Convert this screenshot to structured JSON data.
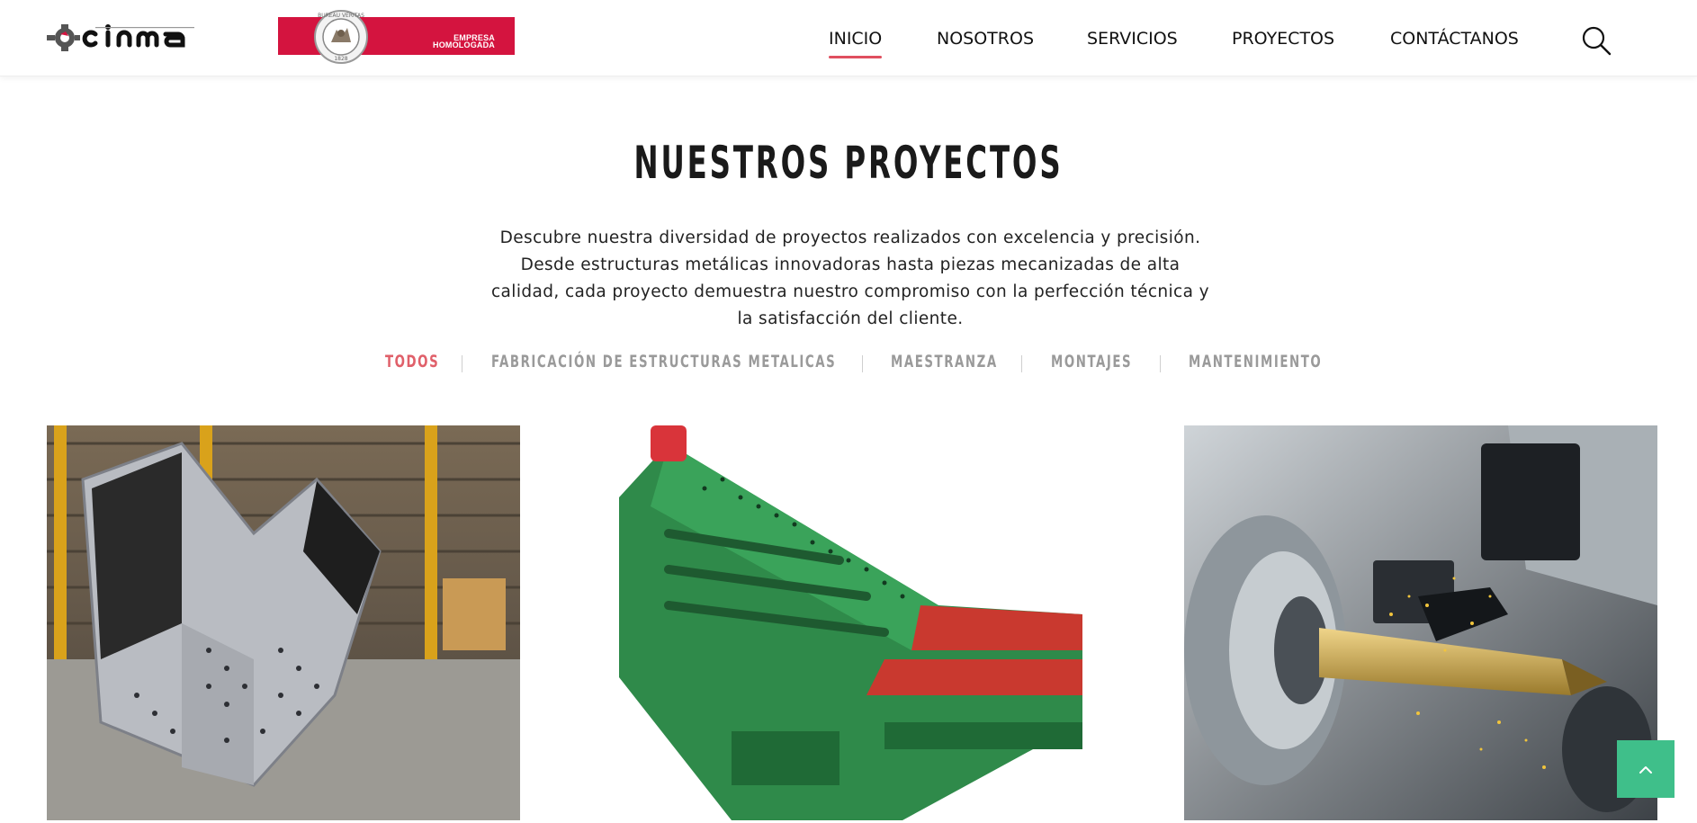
{
  "brand": {
    "logo_text": "cinma",
    "badge_line1": "EMPRESA",
    "badge_line2": "HOMOLOGADA",
    "seal_text": "BUREAU VERITAS",
    "seal_year": "1828"
  },
  "nav": {
    "items": [
      {
        "label": "INICIO",
        "active": true
      },
      {
        "label": "NOSOTROS",
        "active": false
      },
      {
        "label": "SERVICIOS",
        "active": false
      },
      {
        "label": "PROYECTOS",
        "active": false
      },
      {
        "label": "CONTÁCTANOS",
        "active": false
      }
    ],
    "search_icon": "search-icon"
  },
  "section": {
    "title": "NUESTROS PROYECTOS",
    "description_lines": [
      "Descubre nuestra diversidad de proyectos realizados con excelencia y precisión.",
      "Desde estructuras metálicas innovadoras hasta piezas mecanizadas de alta",
      "calidad, cada proyecto demuestra nuestro compromiso con la perfección técnica y",
      "la satisfacción del cliente."
    ]
  },
  "filters": {
    "items": [
      {
        "label": "TODOS",
        "active": true
      },
      {
        "label": "FABRICACIÓN DE ESTRUCTURAS METALICAS",
        "active": false
      },
      {
        "label": "MAESTRANZA",
        "active": false
      },
      {
        "label": "MONTAJES",
        "active": false
      },
      {
        "label": "MANTENIMIENTO",
        "active": false
      }
    ]
  },
  "projects": [
    {
      "image": "steel-crusher-housing"
    },
    {
      "image": "green-vibrating-screen"
    },
    {
      "image": "cnc-lathe-machining"
    }
  ],
  "back_to_top": {
    "icon": "chevron-up-icon"
  },
  "colors": {
    "accent": "#e04f5f",
    "badge_red": "#d4143f",
    "back_to_top": "#3fbf8a",
    "filter_inactive": "#9a9a9a"
  }
}
